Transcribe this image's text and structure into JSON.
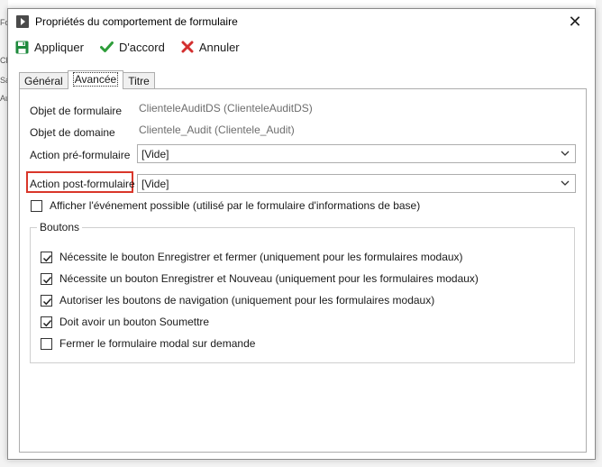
{
  "background": {
    "left_fragments": [
      "Fo",
      "Cli",
      "Sa",
      "Au"
    ]
  },
  "dialog": {
    "title": "Propriétés du comportement de formulaire",
    "close_glyph": "✕"
  },
  "toolbar": {
    "apply_label": "Appliquer",
    "ok_label": "D'accord",
    "cancel_label": "Annuler"
  },
  "tabs": [
    {
      "label": "Général",
      "active": false
    },
    {
      "label": "Avancée",
      "active": true
    },
    {
      "label": "Titre",
      "active": false
    }
  ],
  "fields": {
    "form_object_label": "Objet de formulaire",
    "form_object_value": "ClienteleAuditDS (ClienteleAuditDS)",
    "domain_object_label": "Objet de domaine",
    "domain_object_value": "Clientele_Audit (Clientele_Audit)",
    "pre_action_label": "Action pré-formulaire",
    "pre_action_value": "[Vide]",
    "post_action_label": "Action post-formulaire",
    "post_action_value": "[Vide]",
    "show_event_label": "Afficher l'événement possible (utilisé par le formulaire d'informations de base)",
    "show_event_checked": false
  },
  "buttons_group": {
    "title": "Boutons",
    "options": [
      {
        "label": "Nécessite le bouton Enregistrer et fermer (uniquement pour les formulaires modaux)",
        "checked": true
      },
      {
        "label": "Nécessite un bouton Enregistrer et Nouveau (uniquement pour les formulaires modaux)",
        "checked": true
      },
      {
        "label": "Autoriser les boutons de navigation (uniquement pour les formulaires modaux)",
        "checked": true
      },
      {
        "label": "Doit avoir un bouton Soumettre",
        "checked": true
      },
      {
        "label": "Fermer le formulaire modal sur demande",
        "checked": false
      }
    ]
  },
  "colors": {
    "save_icon": "#1e8a3c",
    "ok_icon": "#2e9d3a",
    "cancel_icon": "#d32f2f",
    "highlight": "#d9362a"
  }
}
